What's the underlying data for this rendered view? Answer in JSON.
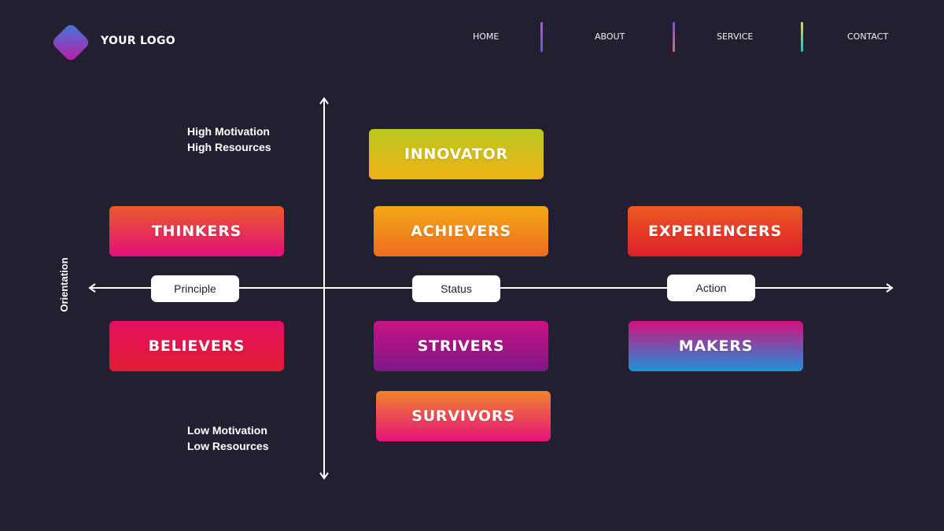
{
  "header": {
    "logo_text": "YOUR LOGO",
    "nav": [
      "HOME",
      "ABOUT",
      "SERVICE",
      "CONTACT"
    ]
  },
  "diagram": {
    "y_axis_top_label": [
      "High Motivation",
      "High Resources"
    ],
    "y_axis_bottom_label": [
      "Low Motivation",
      "Low Resources"
    ],
    "x_axis_label": "Orientation",
    "orientations": [
      "Principle",
      "Status",
      "Action"
    ],
    "segments": {
      "innovator": "INNOVATOR",
      "thinkers": "THINKERS",
      "achievers": "ACHIEVERS",
      "experiencers": "EXPERIENCERS",
      "believers": "BELIEVERS",
      "strivers": "STRIVERS",
      "makers": "MAKERS",
      "survivors": "SURVIVORS"
    }
  },
  "colors": {
    "background": "#222030",
    "innovator": [
      "#b9ca1e",
      "#f0b017"
    ],
    "thinkers": [
      "#ea5a2a",
      "#e2107a"
    ],
    "achievers": [
      "#f2a818",
      "#ef6c1f"
    ],
    "experiencers": [
      "#ea5a22",
      "#df1f2c"
    ],
    "believers": [
      "#e50f60",
      "#e11d34"
    ],
    "strivers": [
      "#cc1282",
      "#7c1889"
    ],
    "makers": [
      "#d3117f",
      "#1e92d8"
    ],
    "survivors": [
      "#f1842a",
      "#e5127c"
    ]
  }
}
